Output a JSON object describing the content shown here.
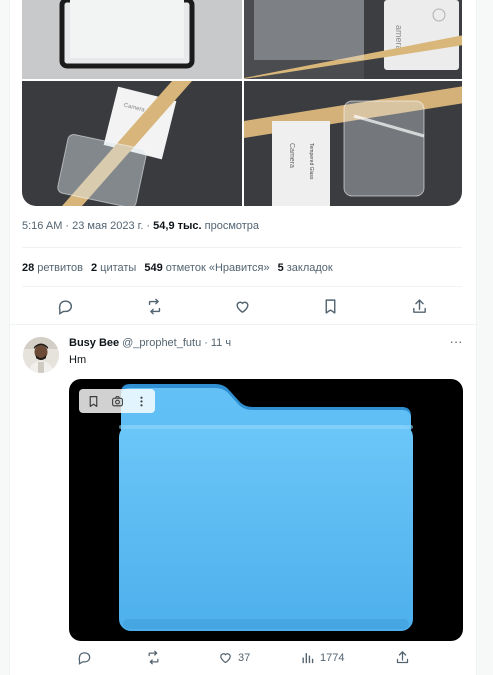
{
  "tweet1": {
    "timestamp": "5:16 AM · 23 мая 2023 г. ·",
    "views_count": "54,9 тыс.",
    "views_label": "просмотра",
    "stats": [
      {
        "count": "28",
        "label": "ретвитов"
      },
      {
        "count": "2",
        "label": "цитаты"
      },
      {
        "count": "549",
        "label": "отметок «Нравится»"
      },
      {
        "count": "5",
        "label": "закладок"
      }
    ],
    "actions": [
      "reply-icon",
      "retweet-icon",
      "like-icon",
      "bookmark-icon",
      "share-icon"
    ]
  },
  "tweet2": {
    "name": "Busy Bee",
    "handle": "@_prophet_futu",
    "separator": "·",
    "time": "11 ч",
    "more": "···",
    "text": "Hm",
    "media_overlay": [
      "bookmark-icon",
      "camera-search-icon",
      "more-vertical-icon"
    ],
    "likes": "37",
    "views": "1774"
  },
  "colors": {
    "text_primary": "#0f1419",
    "text_secondary": "#536471",
    "divider": "#eff3f4",
    "folder_blue": "#4fb4ef"
  }
}
